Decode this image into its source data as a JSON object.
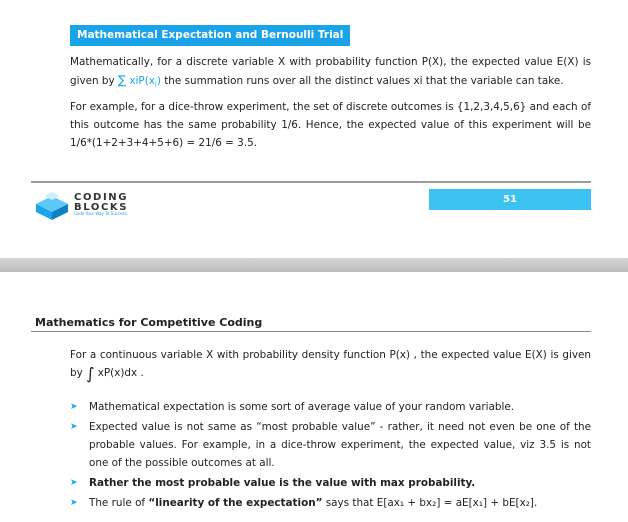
{
  "top_page": {
    "heading": "Mathematical Expectation and Bernoulli Trial",
    "para1_before": "Mathematically, for a discrete variable X with probability function P(X), the expected value E(X) is given by",
    "para1_sum_symbol": "∑",
    "para1_sum_term": "xiP(x",
    "para1_sum_sub": "i",
    "para1_sum_close": ")",
    "para1_after": "the summation runs over all the distinct values xi that the variable can take.",
    "para2": "For example, for a dice-throw experiment, the set of discrete outcomes is {1,2,3,4,5,6} and each of this outcome has the same probability 1/6. Hence, the expected value of this experiment will be 1/6*(1+2+3+4+5+6) = 21/6 = 3.5.",
    "footer": {
      "logo_line1": "CODING",
      "logo_line2": "BLOCKS",
      "logo_tagline": "Code Your Way To Success",
      "page_number": "51"
    }
  },
  "bottom_page": {
    "header_title": "Mathematics for Competitive Coding",
    "para1_before": "For a continuous variable X with probability density function P(x) , the expected value E(X) is given by",
    "para1_integral": "∫",
    "para1_integrand": "xP(x)dx .",
    "bullets": [
      {
        "text": "Mathematical expectation is some sort of average value of your random variable."
      },
      {
        "text": "Expected value is not same as “most probable value” - rather, it need not even be one of the probable values. For example, in a dice-throw experiment, the expected value, viz 3.5 is not one of the possible outcomes at all."
      },
      {
        "text": "Rather the most probable value is the value with max probability."
      },
      {
        "text_before": "The rule of",
        "bold": "“linearity of the expectation”",
        "text_after": "says that E[ax₁ + bx₂] = aE[x₁] + bE[x₂]."
      }
    ]
  },
  "colors": {
    "accent": "#1aa3e8",
    "page_number_bg": "#3cc2f0"
  }
}
